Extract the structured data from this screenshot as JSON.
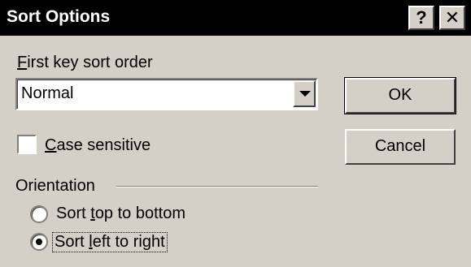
{
  "window": {
    "title": "Sort Options",
    "help_glyph": "?",
    "close_glyph": "✕"
  },
  "first_key": {
    "label_accel": "F",
    "label_rest": "irst key sort order",
    "value": "Normal"
  },
  "buttons": {
    "ok": "OK",
    "cancel": "Cancel"
  },
  "case_sensitive": {
    "label_accel": "C",
    "label_rest": "ase sensitive",
    "checked": false
  },
  "orientation": {
    "label": "Orientation",
    "options": [
      {
        "pre": "Sort ",
        "accel": "t",
        "post": "op to bottom",
        "selected": false
      },
      {
        "pre": "Sort ",
        "accel": "l",
        "post": "eft to right",
        "selected": true
      }
    ]
  }
}
